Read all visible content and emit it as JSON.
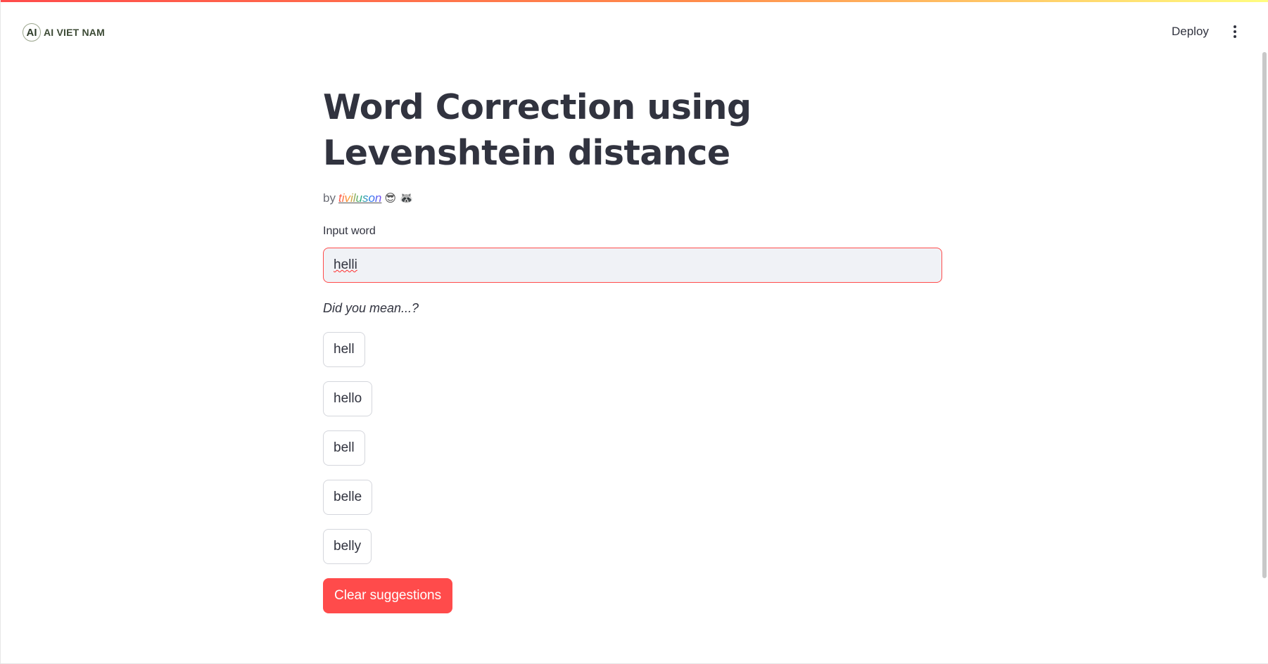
{
  "header": {
    "logo_mark": "AI",
    "logo_text": "AI VIET NAM",
    "deploy_label": "Deploy",
    "menu_icon": "kebab-menu-icon"
  },
  "main": {
    "title": "Word Correction using Levenshtein distance",
    "byline": {
      "prefix": "by",
      "author": "tiviluson",
      "emojis": "😎 🦝"
    },
    "input": {
      "label": "Input word",
      "value": "helli"
    },
    "prompt": "Did you mean...?",
    "suggestions": [
      "hell",
      "hello",
      "bell",
      "belle",
      "belly"
    ],
    "clear_label": "Clear suggestions"
  },
  "colors": {
    "accent": "#ff4b4b",
    "text": "#31333f",
    "input_bg": "#f0f2f6"
  }
}
